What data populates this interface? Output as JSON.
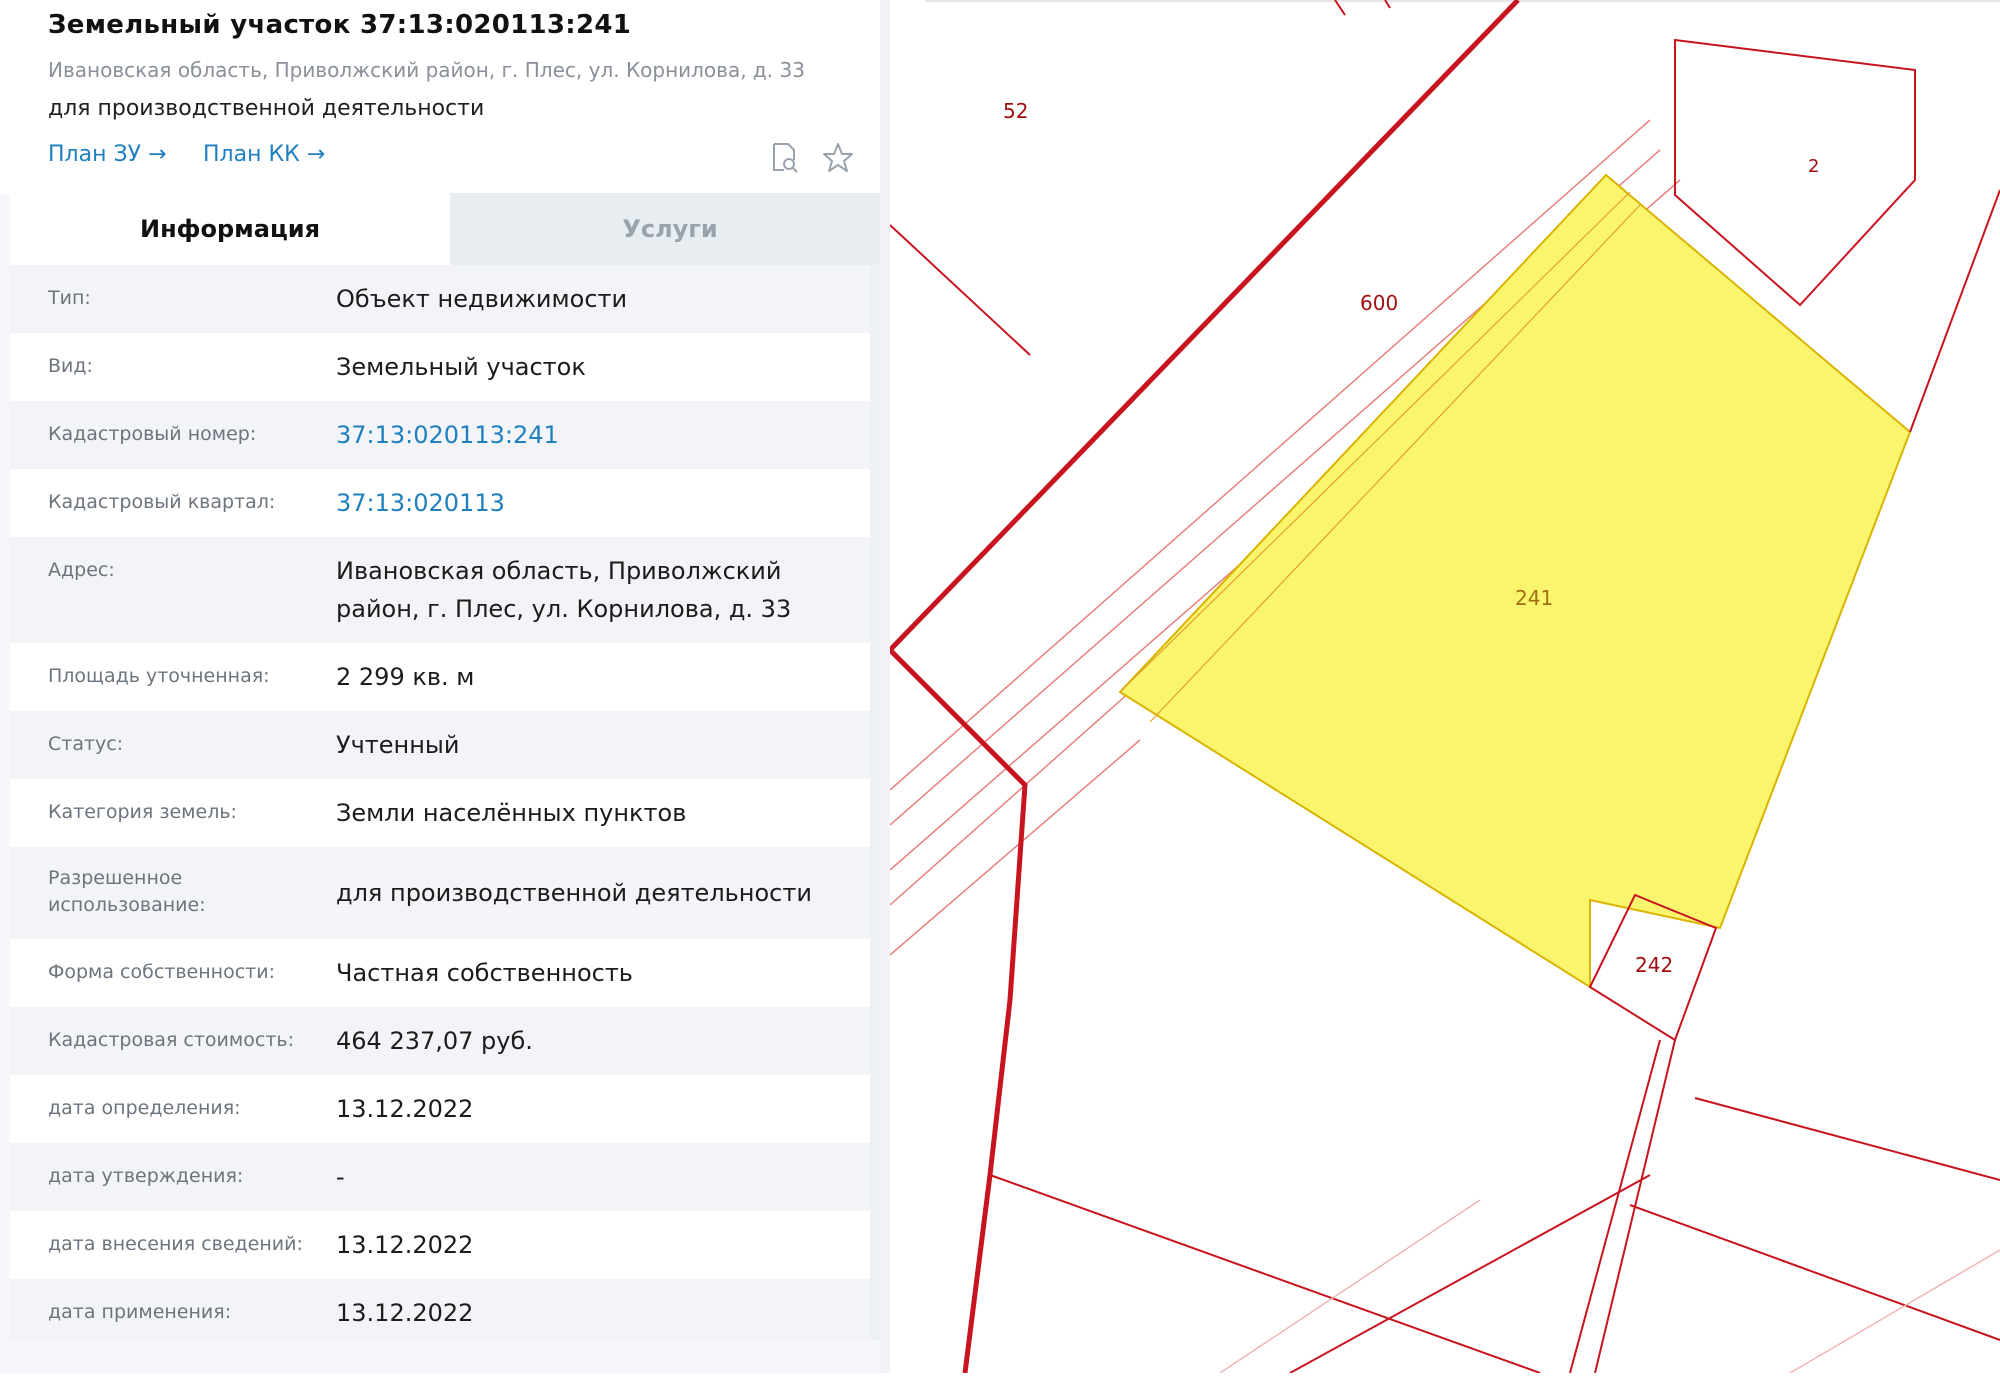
{
  "header": {
    "title": "Земельный участок 37:13:020113:241",
    "address": "Ивановская область, Приволжский район, г. Плес, ул. Корнилова, д. 33",
    "purpose": "для производственной деятельности",
    "plan_zu_label": "План ЗУ →",
    "plan_kk_label": "План КК →",
    "icons": [
      "preview-search-icon",
      "star-icon"
    ]
  },
  "tabs": {
    "info": "Информация",
    "services": "Услуги"
  },
  "details": [
    {
      "label": "Тип:",
      "value": "Объект недвижимости"
    },
    {
      "label": "Вид:",
      "value": "Земельный участок"
    },
    {
      "label": "Кадастровый номер:",
      "value": "37:13:020113:241"
    },
    {
      "label": "Кадастровый квартал:",
      "value": "37:13:020113"
    },
    {
      "label": "Адрес:",
      "value": "Ивановская область, Приволжский район, г. Плес, ул. Корнилова, д. 33"
    },
    {
      "label": "Площадь уточненная:",
      "value": "2 299 кв. м"
    },
    {
      "label": "Статус:",
      "value": "Учтенный"
    },
    {
      "label": "Категория земель:",
      "value": "Земли населённых пунктов"
    },
    {
      "label": "Разрешенное использование:",
      "value": "для производственной деятельности"
    },
    {
      "label": "Форма собственности:",
      "value": "Частная собственность"
    },
    {
      "label": "Кадастровая стоимость:",
      "value": "464 237,07 руб."
    },
    {
      "label": "дата определения:",
      "value": "13.12.2022"
    },
    {
      "label": "дата утверждения:",
      "value": "-"
    },
    {
      "label": "дата внесения сведений:",
      "value": "13.12.2022"
    },
    {
      "label": "дата применения:",
      "value": "13.12.2022"
    }
  ],
  "map": {
    "parcel_labels": {
      "p52": "52",
      "p2": "2",
      "p600": "600",
      "p241": "241",
      "p242": "242"
    },
    "colors": {
      "boundary": "#c8141e",
      "boundary_thin": "#e05a5a",
      "selected_fill": "#fbf56e",
      "selected_stroke": "#d9b400",
      "label": "#a01010"
    }
  }
}
